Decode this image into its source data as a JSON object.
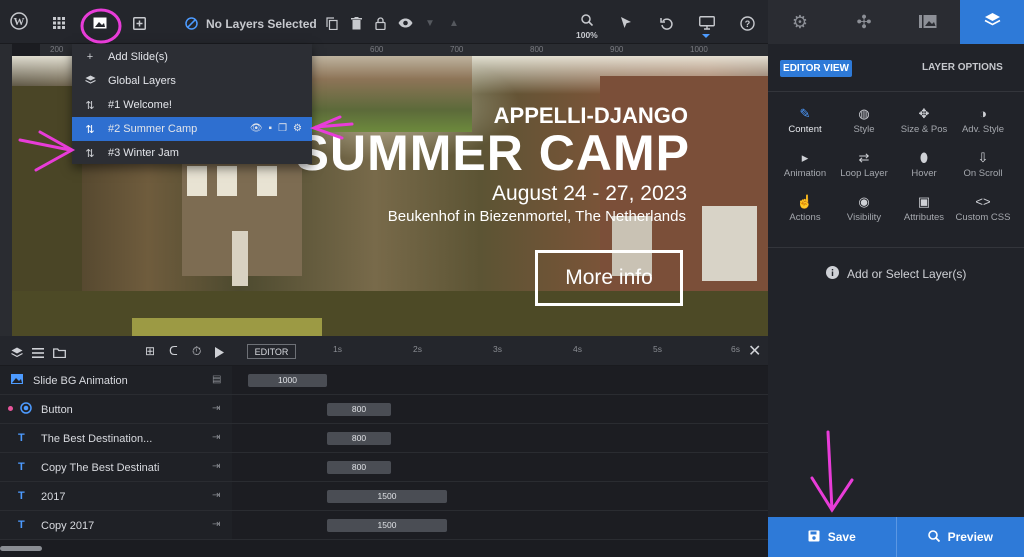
{
  "toolbar": {
    "layer_status": "No Layers Selected",
    "zoom": "100%"
  },
  "ruler": {
    "ticks": [
      "200",
      "300",
      "400",
      "500",
      "600",
      "700",
      "800",
      "900",
      "1000"
    ]
  },
  "slide_menu": {
    "items": [
      {
        "label": "Add Slide(s)",
        "icon": "plus"
      },
      {
        "label": "Global Layers",
        "icon": "layers"
      },
      {
        "label": "#1 Welcome!",
        "icon": "sort"
      },
      {
        "label": "#2 Summer Camp",
        "icon": "sort",
        "selected": true
      },
      {
        "label": "#3 Winter Jam",
        "icon": "sort"
      }
    ]
  },
  "hero": {
    "kicker": "APPELLI-DJANGO",
    "title": "SUMMER CAMP",
    "date": "August 24 - 27, 2023",
    "location": "Beukenhof in Biezenmortel, The Netherlands",
    "button": "More info"
  },
  "sidebar": {
    "editor_view": "EDITOR VIEW",
    "layer_options": "LAYER OPTIONS",
    "options": [
      {
        "label": "Content",
        "icon": "pencil-icon",
        "active": true
      },
      {
        "label": "Style",
        "icon": "palette-icon"
      },
      {
        "label": "Size & Pos",
        "icon": "move-icon"
      },
      {
        "label": "Adv. Style",
        "icon": "contrast-icon"
      },
      {
        "label": "Animation",
        "icon": "play-icon"
      },
      {
        "label": "Loop Layer",
        "icon": "loop-icon"
      },
      {
        "label": "Hover",
        "icon": "mouse-icon"
      },
      {
        "label": "On Scroll",
        "icon": "scroll-icon"
      },
      {
        "label": "Actions",
        "icon": "pointer-icon"
      },
      {
        "label": "Visibility",
        "icon": "eye-icon"
      },
      {
        "label": "Attributes",
        "icon": "image-icon"
      },
      {
        "label": "Custom CSS",
        "icon": "code-icon"
      }
    ],
    "hint": "Add or Select Layer(s)",
    "save": "Save",
    "preview": "Preview"
  },
  "timeline": {
    "editor_tab": "EDITOR",
    "seconds": [
      "1s",
      "2s",
      "3s",
      "4s",
      "5s",
      "6s"
    ],
    "layers": [
      {
        "name": "Slide BG Animation",
        "type": "image",
        "duration": "1000"
      },
      {
        "name": "Button",
        "type": "button",
        "duration": "800"
      },
      {
        "name": "The Best Destination...",
        "type": "text",
        "duration": "800"
      },
      {
        "name": "Copy The Best Destinati",
        "type": "text",
        "duration": "800"
      },
      {
        "name": "2017",
        "type": "text",
        "duration": "1500"
      },
      {
        "name": "Copy 2017",
        "type": "text",
        "duration": "1500"
      }
    ]
  },
  "colors": {
    "accent": "#2e7ad8",
    "annotation": "#e83cd8"
  }
}
